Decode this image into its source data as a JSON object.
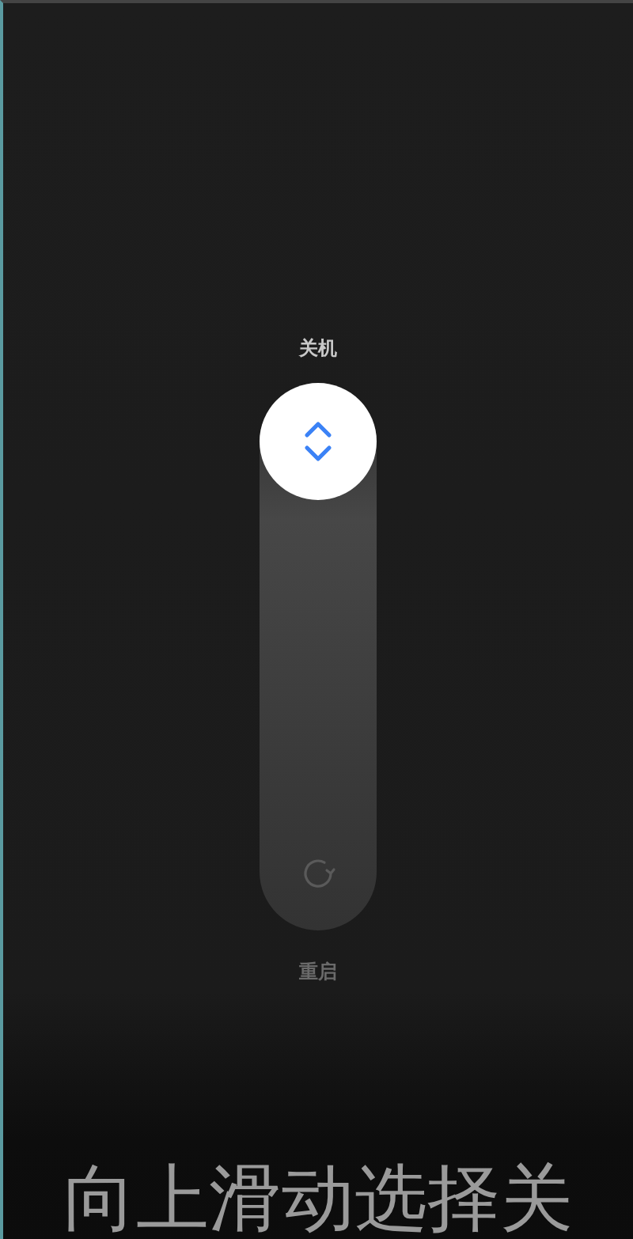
{
  "top_label": "关机",
  "slider": {
    "level": 1
  },
  "bottom_label": "重启",
  "caption": "向上滑动选择关"
}
